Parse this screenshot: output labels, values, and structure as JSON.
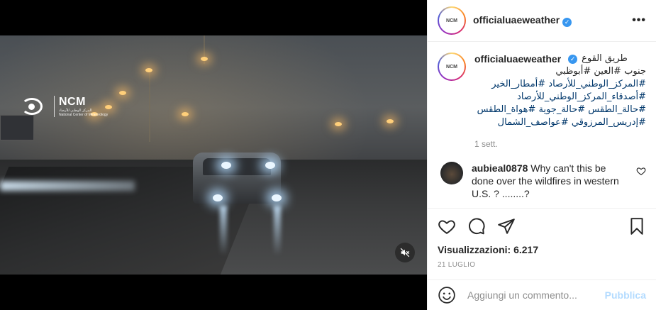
{
  "post": {
    "username": "officialuaeweather",
    "caption_line1": "طريق القوع",
    "caption_line2": "جنوب #العين #أبوظبي",
    "caption_line3": "#المركز_الوطني_للأرصاد #أمطار_الخير",
    "caption_line4": "#أصدقاء_المركز_الوطني_للأرصاد",
    "caption_line5": "#حالة_الطقس #حالة_جوية #هواة_الطقس",
    "caption_line6": "#إدريس_المرزوقي #عواصف_الشمال",
    "time_ago": "1 sett.",
    "views_label": "Visualizzazioni: 6.217",
    "date": "21 LUGLIO"
  },
  "video": {
    "logo_title": "NCM",
    "logo_sub_ar": "المركز الوطني للأرصاد",
    "logo_sub_en": "National Center of Meteorology"
  },
  "comment": {
    "username": "aubieal0878",
    "text": "Why can't this be done over the wildfires in western",
    "text_cut": "U.S. ? ........?"
  },
  "add_comment": {
    "placeholder": "Aggiungi un commento...",
    "publish_label": "Pubblica"
  },
  "avatar_text": "NCM",
  "colors": {
    "link": "#00376b",
    "verified": "#3897f0",
    "publish_disabled": "#b3dbff",
    "muted": "#8e8e8e"
  },
  "icons": [
    "more-icon",
    "verified-icon",
    "heart-icon",
    "comment-icon",
    "share-icon",
    "bookmark-icon",
    "emoji-icon",
    "mute-icon"
  ]
}
